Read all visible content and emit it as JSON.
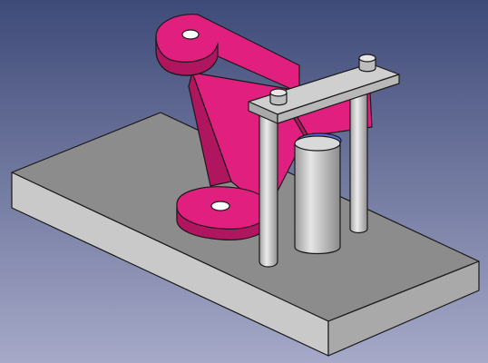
{
  "view": {
    "background_top": "#3e4a78",
    "background_bottom": "#a6a9c8"
  },
  "colors": {
    "base_top": "#8c8c8c",
    "base_front": "#c9c9c9",
    "base_side": "#a9a9a9",
    "part_magenta": "#e01f7f",
    "part_magenta_dark": "#b0155f",
    "part_magenta_light": "#f0509f",
    "steel_light": "#d9d9d9",
    "steel_mid": "#b8b8b8",
    "steel_dark": "#8f8f8f",
    "plate_top": "#cfcfcf",
    "bushing_blue": "#5c6bd6",
    "edge": "#1a1a1a"
  },
  "scene": {
    "parts": [
      {
        "name": "base-plate"
      },
      {
        "name": "magenta-bracket"
      },
      {
        "name": "top-plate"
      },
      {
        "name": "guide-rod-left"
      },
      {
        "name": "guide-rod-right"
      },
      {
        "name": "center-cylinder"
      }
    ]
  }
}
